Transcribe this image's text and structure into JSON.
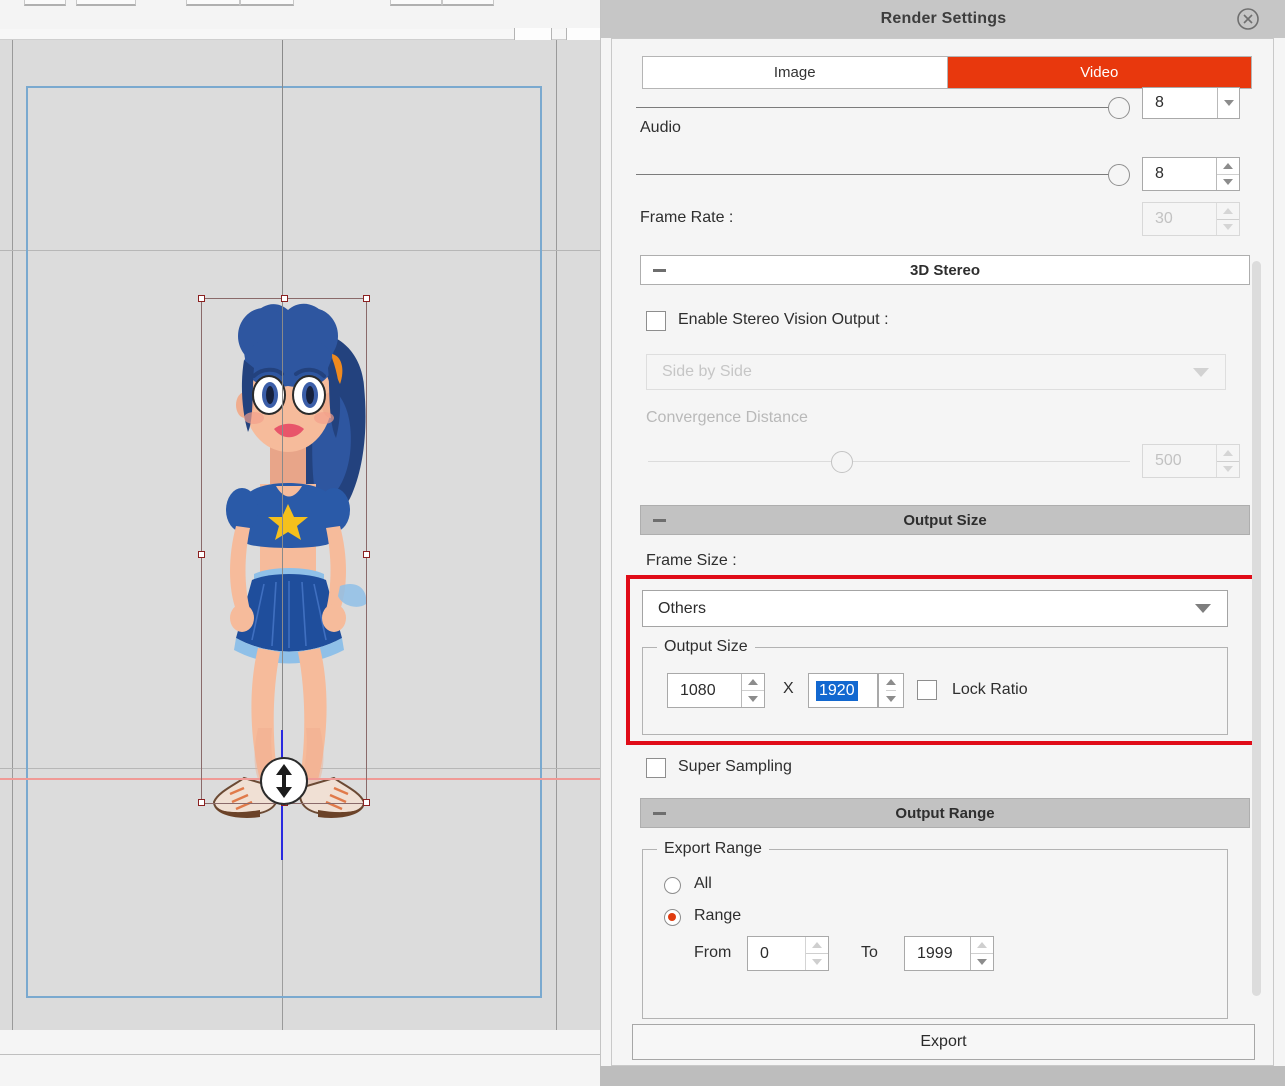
{
  "canvas": {
    "name": "animation-stage",
    "character_alt": "cartoon-girl-character"
  },
  "dialog": {
    "title": "Render Settings",
    "close_icon": "close-circle-icon",
    "tabs": [
      {
        "label": "Image",
        "selected": false
      },
      {
        "label": "Video",
        "selected": true
      }
    ],
    "accent_color": "#e8380d",
    "quality": {
      "value": "8",
      "partial_label": "8"
    },
    "audio": {
      "label": "Audio",
      "value": "8"
    },
    "frame_rate": {
      "label": "Frame Rate :",
      "value": "30",
      "disabled": true
    },
    "stereo": {
      "header": "3D Stereo",
      "collapse_icon": "minus-icon",
      "enable_label": "Enable Stereo Vision Output :",
      "enable_checked": false,
      "mode_value": "Side by Side",
      "mode_disabled": true,
      "convergence_label": "Convergence Distance",
      "convergence_value": "500",
      "convergence_disabled": true
    },
    "output_size": {
      "header": "Output Size",
      "collapse_icon": "minus-icon",
      "frame_size_label": "Frame Size :",
      "frame_size_value": "Others",
      "group_legend": "Output Size",
      "width": "1080",
      "separator": "X",
      "height": "1920",
      "height_selected": true,
      "lock_ratio_label": "Lock Ratio",
      "lock_ratio_checked": false,
      "highlight_color": "#e00c18"
    },
    "super_sampling": {
      "label": "Super Sampling",
      "checked": false
    },
    "output_range": {
      "header": "Output Range",
      "collapse_icon": "minus-icon",
      "group_legend": "Export Range",
      "options": [
        {
          "label": "All",
          "selected": false
        },
        {
          "label": "Range",
          "selected": true
        }
      ],
      "from_label": "From",
      "from_value": "0",
      "to_label": "To",
      "to_value": "1999"
    },
    "export_button": "Export"
  }
}
